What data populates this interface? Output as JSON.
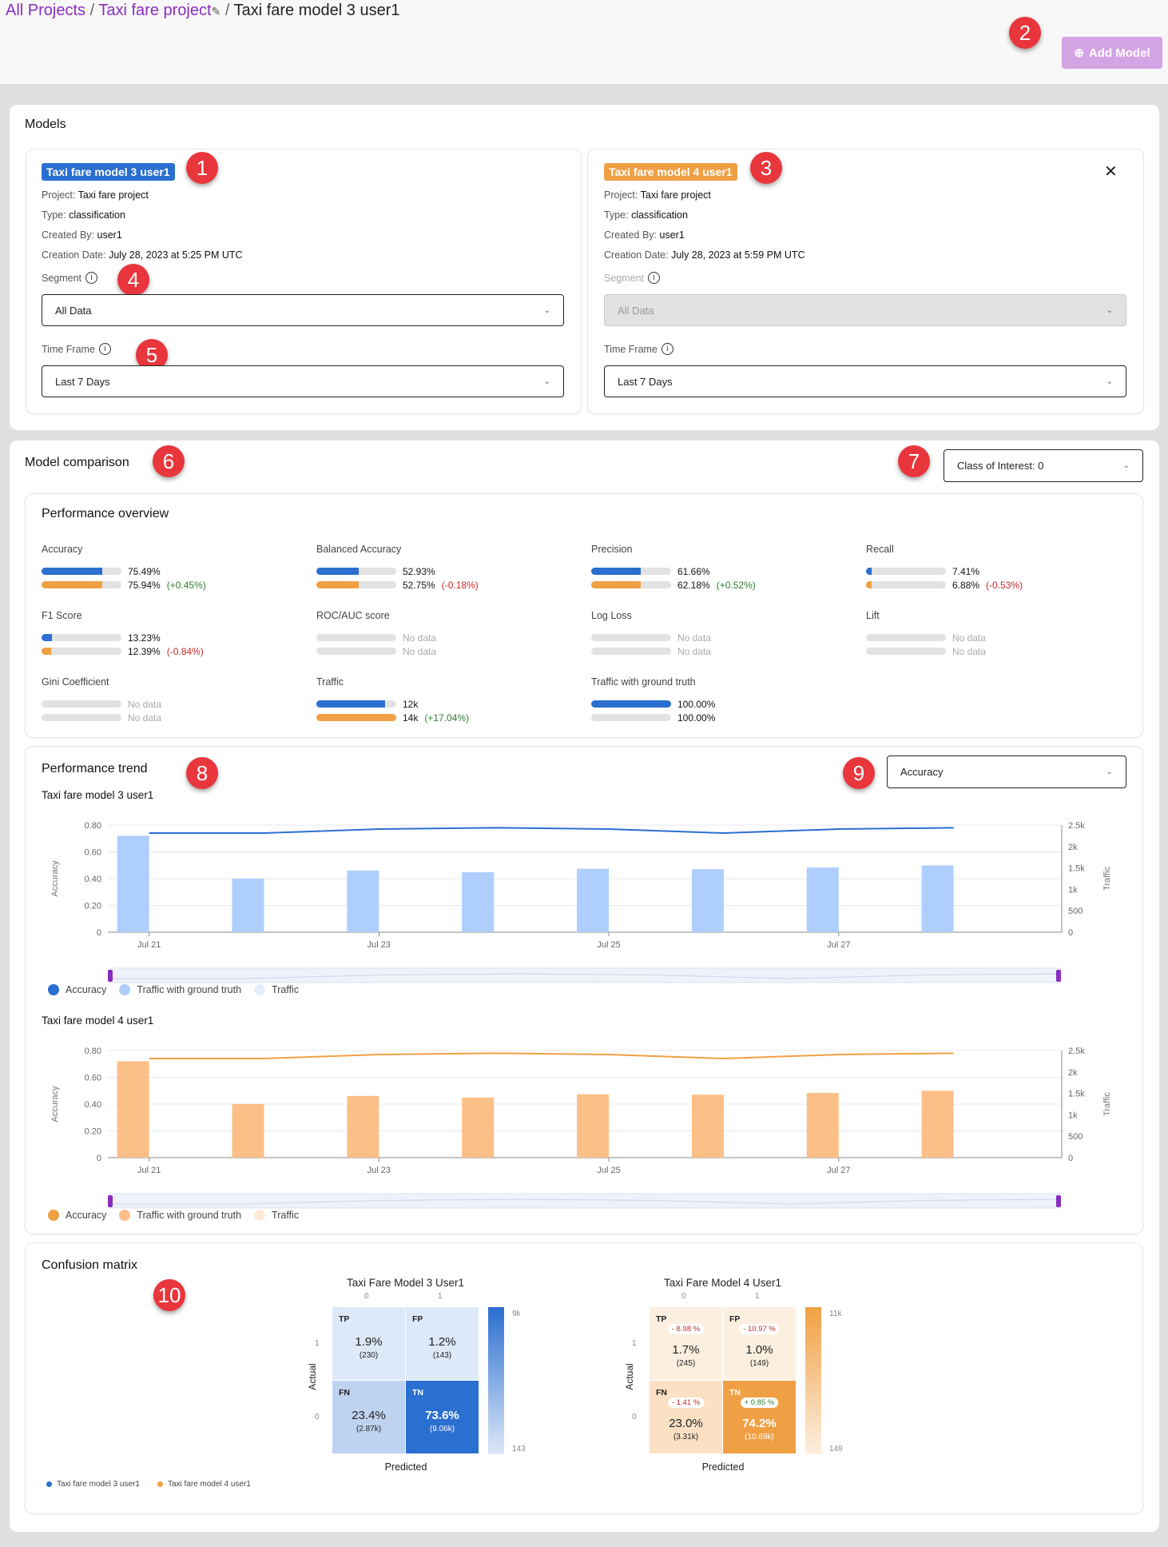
{
  "breadcrumb": {
    "all_projects": "All Projects",
    "project": "Taxi fare project",
    "current": "Taxi fare model 3 user1",
    "separator": "/"
  },
  "header": {
    "add_model_label": "Add Model"
  },
  "annotations": [
    "1",
    "2",
    "3",
    "4",
    "5",
    "6",
    "7",
    "8",
    "9",
    "10"
  ],
  "models": {
    "title": "Models",
    "cards": [
      {
        "name": "Taxi fare model 3 user1",
        "color": "#2b6fd0",
        "project_label": "Project:",
        "project": "Taxi fare project",
        "type_label": "Type:",
        "type": "classification",
        "created_by_label": "Created By:",
        "created_by": "user1",
        "date_label": "Creation Date:",
        "date": "July 28, 2023 at 5:25 PM UTC",
        "segment_label": "Segment",
        "segment": "All Data",
        "timeframe_label": "Time Frame",
        "timeframe": "Last 7 Days"
      },
      {
        "name": "Taxi fare model 4 user1",
        "color": "#f0a044",
        "project_label": "Project:",
        "project": "Taxi fare project",
        "type_label": "Type:",
        "type": "classification",
        "created_by_label": "Created By:",
        "created_by": "user1",
        "date_label": "Creation Date:",
        "date": "July 28, 2023 at 5:59 PM UTC",
        "segment_label": "Segment",
        "segment": "All Data",
        "segment_disabled": true,
        "timeframe_label": "Time Frame",
        "timeframe": "Last 7 Days"
      }
    ]
  },
  "comparison": {
    "title": "Model comparison",
    "class_of_interest": "Class of Interest: 0",
    "overview_title": "Performance overview",
    "metrics": [
      {
        "label": "Accuracy",
        "v1": "75.49%",
        "f1": 0.755,
        "v2": "75.94%",
        "f2": 0.759,
        "delta": "(+0.45%)",
        "delta_color": "#2e7d32"
      },
      {
        "label": "Balanced Accuracy",
        "v1": "52.93%",
        "f1": 0.529,
        "v2": "52.75%",
        "f2": 0.528,
        "delta": "(-0.18%)",
        "delta_color": "#c62828"
      },
      {
        "label": "Precision",
        "v1": "61.66%",
        "f1": 0.617,
        "v2": "62.18%",
        "f2": 0.622,
        "delta": "(+0.52%)",
        "delta_color": "#2e7d32"
      },
      {
        "label": "Recall",
        "v1": "7.41%",
        "f1": 0.074,
        "v2": "6.88%",
        "f2": 0.069,
        "delta": "(-0.53%)",
        "delta_color": "#c62828"
      },
      {
        "label": "F1 Score",
        "v1": "13.23%",
        "f1": 0.132,
        "v2": "12.39%",
        "f2": 0.124,
        "delta": "(-0.84%)",
        "delta_color": "#c62828"
      },
      {
        "label": "ROC/AUC score",
        "v1": "No data",
        "f1": 0,
        "v2": "No data",
        "f2": 0,
        "delta": ""
      },
      {
        "label": "Log Loss",
        "v1": "No data",
        "f1": 0,
        "v2": "No data",
        "f2": 0,
        "delta": ""
      },
      {
        "label": "Lift",
        "v1": "No data",
        "f1": 0,
        "v2": "No data",
        "f2": 0,
        "delta": ""
      },
      {
        "label": "Gini Coefficient",
        "v1": "No data",
        "f1": 0,
        "v2": "No data",
        "f2": 0,
        "delta": ""
      },
      {
        "label": "Traffic",
        "v1": "12k",
        "f1": 0.86,
        "v2": "14k",
        "f2": 1.0,
        "delta": "(+17.04%)",
        "delta_color": "#2e7d32"
      },
      {
        "label": "Traffic with ground truth",
        "v1": "100.00%",
        "f1": 1.0,
        "v2": "100.00%",
        "f2": 0.0,
        "delta": ""
      }
    ],
    "trend_title": "Performance trend",
    "trend_metric": "Accuracy",
    "confusion_title": "Confusion matrix"
  },
  "chart_data": [
    {
      "type": "bar+line",
      "title": "Taxi fare model 3 user1",
      "color_line": "#2b6fd0",
      "color_bar": "#aecffd",
      "color_traffic": "#e6eefc",
      "x": [
        "Jul 21",
        "Jul 22",
        "Jul 23",
        "Jul 24",
        "Jul 25",
        "Jul 26",
        "Jul 27",
        "Jul 28"
      ],
      "xticks": [
        "Jul 21",
        "Jul 23",
        "Jul 25",
        "Jul 27"
      ],
      "ylabel": "Accuracy",
      "ylim": [
        0,
        0.8
      ],
      "yticks": [
        "0",
        "0.20",
        "0.40",
        "0.60",
        "0.80"
      ],
      "y2label": "Traffic",
      "y2lim": [
        0,
        2500
      ],
      "y2ticks": [
        "0",
        "500",
        "1k",
        "1.5k",
        "2k",
        "2.5k"
      ],
      "series": [
        {
          "name": "Accuracy",
          "kind": "line",
          "values": [
            0.74,
            0.74,
            0.77,
            0.78,
            0.77,
            0.74,
            0.77,
            0.78
          ]
        },
        {
          "name": "Traffic with ground truth",
          "kind": "bar",
          "values": [
            2250,
            1250,
            1440,
            1400,
            1480,
            1470,
            1510,
            1560
          ]
        },
        {
          "name": "Traffic",
          "kind": "bar",
          "values": []
        }
      ]
    },
    {
      "type": "bar+line",
      "title": "Taxi fare model 4 user1",
      "color_line": "#f0a044",
      "color_bar": "#fdbf88",
      "color_traffic": "#fdebd8",
      "x": [
        "Jul 21",
        "Jul 22",
        "Jul 23",
        "Jul 24",
        "Jul 25",
        "Jul 26",
        "Jul 27",
        "Jul 28"
      ],
      "xticks": [
        "Jul 21",
        "Jul 23",
        "Jul 25",
        "Jul 27"
      ],
      "ylabel": "Accuracy",
      "ylim": [
        0,
        0.8
      ],
      "yticks": [
        "0",
        "0.20",
        "0.40",
        "0.60",
        "0.80"
      ],
      "y2label": "Traffic",
      "y2lim": [
        0,
        2500
      ],
      "y2ticks": [
        "0",
        "500",
        "1k",
        "1.5k",
        "2k",
        "2.5k"
      ],
      "series": [
        {
          "name": "Accuracy",
          "kind": "line",
          "values": [
            0.74,
            0.74,
            0.77,
            0.78,
            0.77,
            0.74,
            0.77,
            0.78
          ]
        },
        {
          "name": "Traffic with ground truth",
          "kind": "bar",
          "values": [
            2250,
            1250,
            1440,
            1400,
            1480,
            1470,
            1510,
            1560
          ]
        },
        {
          "name": "Traffic",
          "kind": "bar",
          "values": []
        }
      ]
    }
  ],
  "confusion": {
    "xlabel": "Predicted",
    "ylabel": "Actual",
    "cols": [
      "0",
      "1"
    ],
    "rows": [
      "1",
      "0"
    ],
    "legend": [
      "Taxi fare model 3 user1",
      "Taxi fare model 4 user1"
    ],
    "matrices": [
      {
        "title": "Taxi Fare Model 3 User1",
        "scale_max": "9k",
        "scale_min": "143",
        "cells": [
          {
            "tag": "TP",
            "pct": "1.9%",
            "count": "(230)",
            "bg": "#dde8f8",
            "fg": "#222"
          },
          {
            "tag": "FP",
            "pct": "1.2%",
            "count": "(143)",
            "bg": "#dde8f8",
            "fg": "#222"
          },
          {
            "tag": "FN",
            "pct": "23.4%",
            "count": "(2.87k)",
            "bg": "#bed3f0",
            "fg": "#222"
          },
          {
            "tag": "TN",
            "pct": "73.6%",
            "count": "(9.06k)",
            "bg": "#2b6fd0",
            "fg": "#fff"
          }
        ]
      },
      {
        "title": "Taxi Fare Model 4 User1",
        "scale_max": "11k",
        "scale_min": "149",
        "cells": [
          {
            "tag": "TP",
            "delta": "- 8.98 %",
            "delta_color": "#c62828",
            "pct": "1.7%",
            "count": "(245)",
            "bg": "#fdefe0",
            "fg": "#222"
          },
          {
            "tag": "FP",
            "delta": "- 10.97 %",
            "delta_color": "#c62828",
            "pct": "1.0%",
            "count": "(149)",
            "bg": "#fdefe0",
            "fg": "#222"
          },
          {
            "tag": "FN",
            "delta": "- 1.41 %",
            "delta_color": "#c62828",
            "pct": "23.0%",
            "count": "(3.31k)",
            "bg": "#fbe0c4",
            "fg": "#222"
          },
          {
            "tag": "TN",
            "delta": "+ 0.85 %",
            "delta_color": "#2e7d32",
            "pct": "74.2%",
            "count": "(10.69k)",
            "bg": "#f0a044",
            "fg": "#fff"
          }
        ]
      }
    ]
  }
}
